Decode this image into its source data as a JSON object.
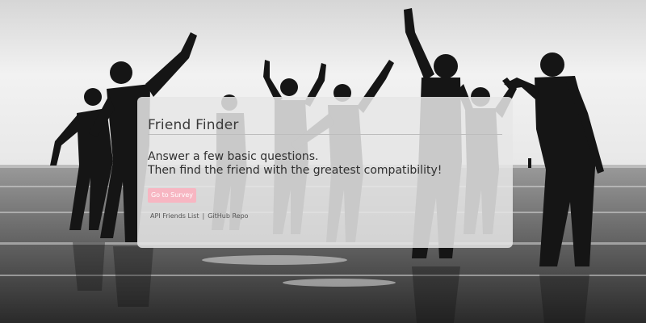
{
  "card": {
    "title": "Friend Finder",
    "lead_line_1": "Answer a few basic questions.",
    "lead_line_2": "Then find the friend with the greatest compatibility!",
    "survey_button": "Go to Survey",
    "api_link": "API Friends List",
    "separator": "|",
    "repo_link": "GitHub Repo"
  },
  "colors": {
    "button": "#f7b6c2",
    "card": "#e6e6e6"
  }
}
